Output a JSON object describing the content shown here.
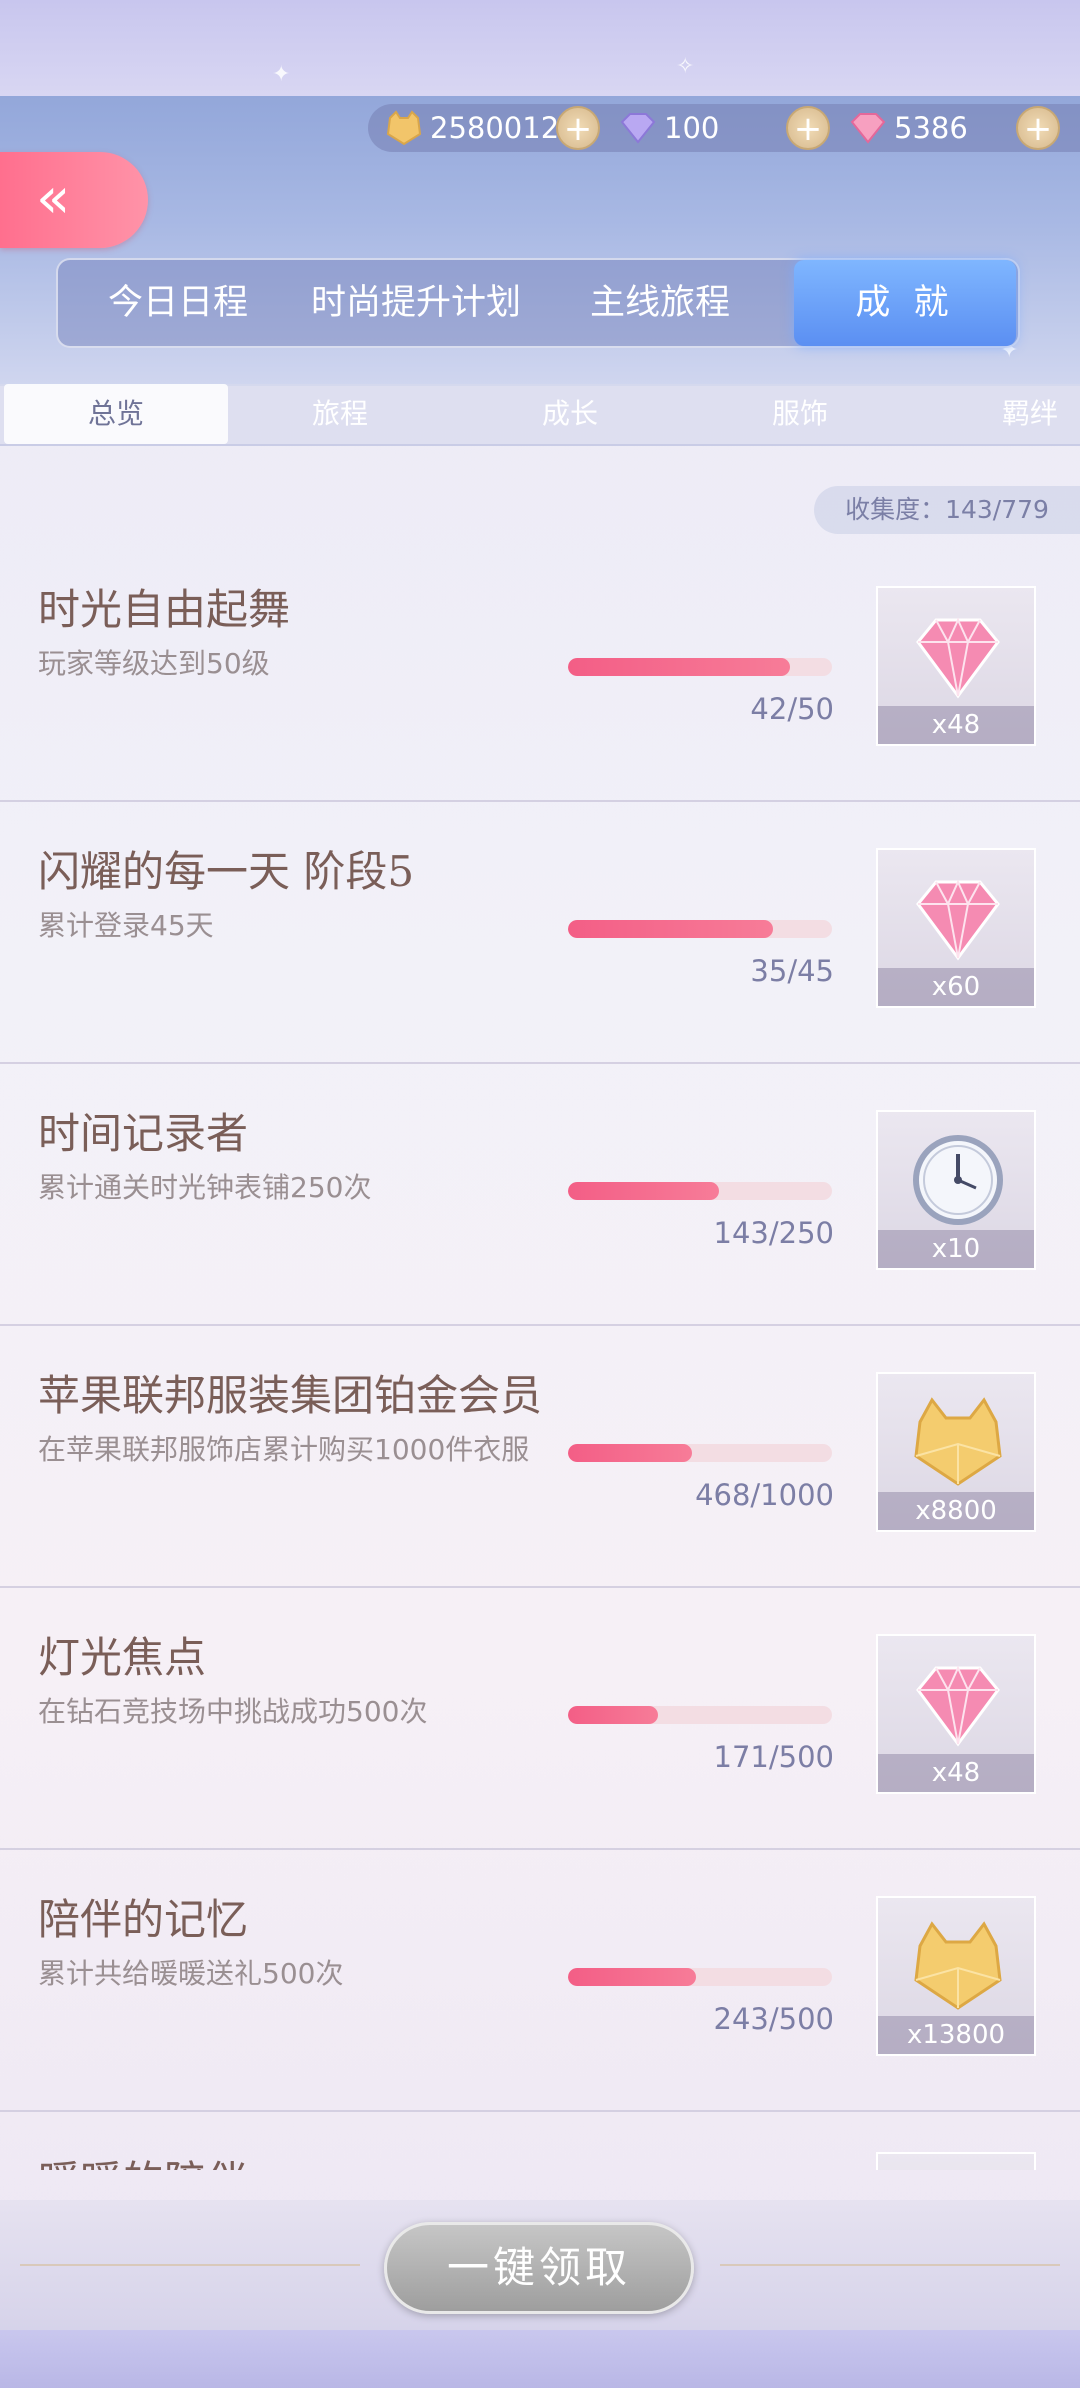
{
  "currency": {
    "coin": "2580012",
    "diamond": "100",
    "pink_diamond": "5386",
    "plus": "+"
  },
  "back_label": "«",
  "main_tabs": [
    "今日日程",
    "时尚提升计划",
    "主线旅程",
    "成 就"
  ],
  "sub_tabs": [
    "总览",
    "旅程",
    "成长",
    "服饰",
    "羁绊"
  ],
  "collection": "收集度：143/779",
  "achievements": [
    {
      "title": "时光自由起舞",
      "desc": "玩家等级达到50级",
      "progress": "42/50",
      "fraction": 0.84,
      "reward_icon": "pink-diamond-icon",
      "reward_count": "x48"
    },
    {
      "title": "闪耀的每一天 阶段5",
      "desc": "累计登录45天",
      "progress": "35/45",
      "fraction": 0.778,
      "reward_icon": "pink-diamond-icon",
      "reward_count": "x60"
    },
    {
      "title": "时间记录者",
      "desc": "累计通关时光钟表铺250次",
      "progress": "143/250",
      "fraction": 0.572,
      "reward_icon": "clock-icon",
      "reward_count": "x10"
    },
    {
      "title": "苹果联邦服装集团铂金会员",
      "desc": "在苹果联邦服饰店累计购买1000件衣服",
      "progress": "468/1000",
      "fraction": 0.468,
      "reward_icon": "gold-cat-coin-icon",
      "reward_count": "x8800"
    },
    {
      "title": "灯光焦点",
      "desc": "在钻石竞技场中挑战成功500次",
      "progress": "171/500",
      "fraction": 0.342,
      "reward_icon": "pink-diamond-icon",
      "reward_count": "x48"
    },
    {
      "title": "陪伴的记忆",
      "desc": "累计共给暖暖送礼500次",
      "progress": "243/500",
      "fraction": 0.486,
      "reward_icon": "gold-cat-coin-icon",
      "reward_count": "x13800"
    },
    {
      "title": "暖暖的陪伴",
      "desc": "",
      "progress": "",
      "fraction": 0,
      "reward_icon": "",
      "reward_count": ""
    }
  ],
  "claim_all": "一键领取",
  "colors": {
    "accent_pink": "#f35e86",
    "active_tab": "#5b8ff2",
    "title_brown": "#7a5e58"
  }
}
